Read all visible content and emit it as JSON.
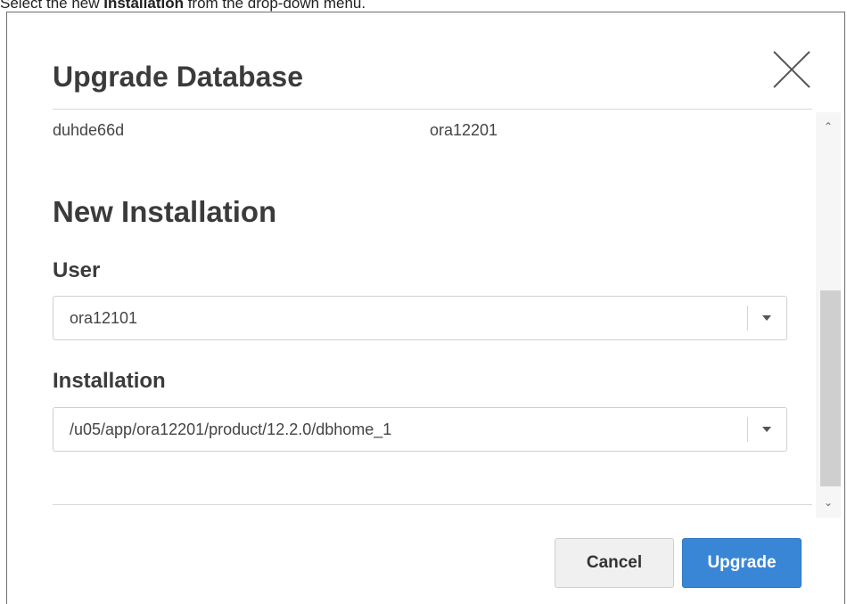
{
  "instruction": {
    "prefix": "Select the new ",
    "bold": "Installation",
    "suffix": " from the drop-down menu."
  },
  "dialog": {
    "title": "Upgrade Database",
    "close_icon": "close-icon"
  },
  "current": {
    "database": "duhde66d",
    "user": "ora12201"
  },
  "new_installation": {
    "heading": "New Installation",
    "user_label": "User",
    "user_value": "ora12101",
    "installation_label": "Installation",
    "installation_value": "/u05/app/ora12201/product/12.2.0/dbhome_1"
  },
  "buttons": {
    "cancel": "Cancel",
    "upgrade": "Upgrade"
  },
  "colors": {
    "primary": "#3a86d6",
    "secondary": "#f0f0f0"
  }
}
